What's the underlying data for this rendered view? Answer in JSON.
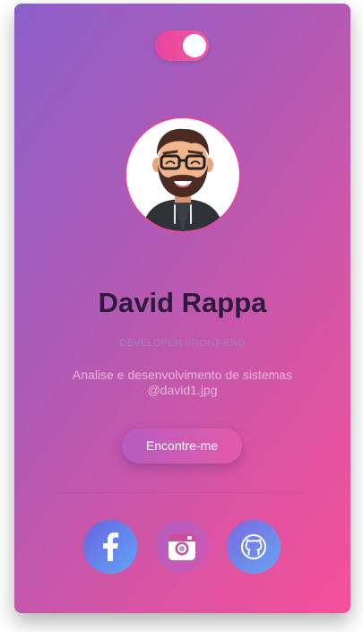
{
  "theme": {
    "toggle_state": "on",
    "accent": "#e8449c",
    "gradient_start": "#8b5fc9",
    "gradient_end": "#f54f9a"
  },
  "profile": {
    "name": "David Rappa",
    "role": "DEVELOPER FRONT-END",
    "description": "Analise e desenvolvimento de sistemas",
    "handle": "@david1.jpg",
    "avatar_icon": "cartoon-bearded-man-avatar"
  },
  "cta": {
    "label": "Encontre-me"
  },
  "social": [
    {
      "name": "facebook",
      "icon": "facebook-icon"
    },
    {
      "name": "instagram",
      "icon": "instagram-icon"
    },
    {
      "name": "github",
      "icon": "github-icon"
    }
  ]
}
